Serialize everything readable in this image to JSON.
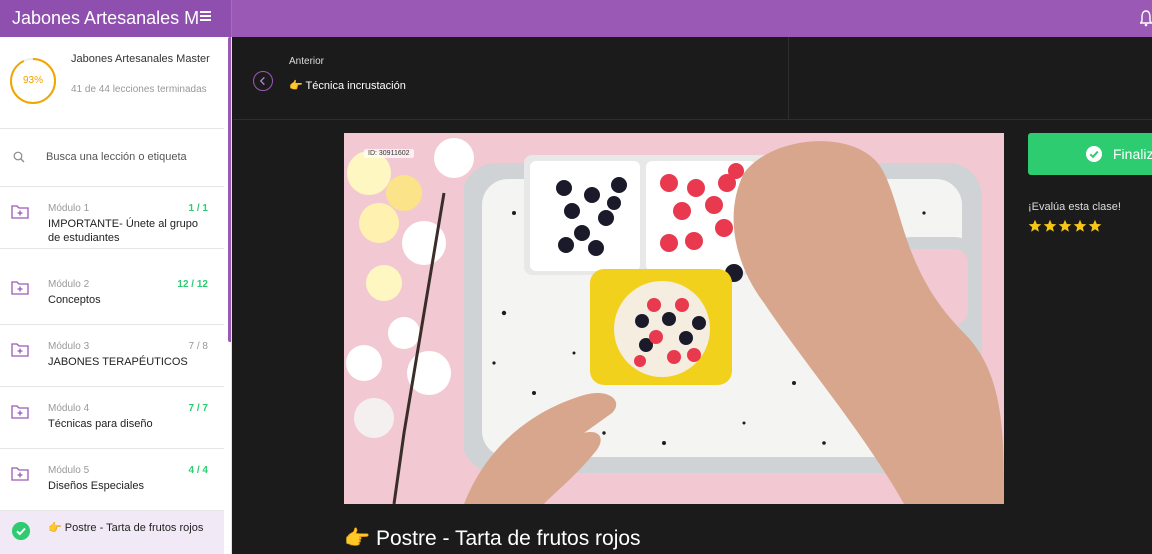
{
  "topbar": {
    "course_name": "Jabones Artesanales M",
    "menu_icon": "hamburger-menu-icon",
    "bell_icon": "bell-icon",
    "brand_color": "#9b59b6"
  },
  "sidebar": {
    "progress_percent": "93%",
    "progress_fraction": 0.93,
    "course_title": "Jabones Artesanales Master",
    "lessons_done": "41 de 44 lecciones terminadas",
    "search_placeholder": "Busca una lección o etiqueta",
    "modules": [
      {
        "num": "Módulo 1",
        "count": "1 / 1",
        "title": "IMPORTANTE- Únete al grupo de estudiantes",
        "complete": true
      },
      {
        "num": "Módulo 2",
        "count": "12 / 12",
        "title": "Conceptos",
        "complete": true
      },
      {
        "num": "Módulo 3",
        "count": "7 / 8",
        "title": "JABONES TERAPÉUTICOS",
        "complete": false
      },
      {
        "num": "Módulo 4",
        "count": "7 / 7",
        "title": "Técnicas para diseño",
        "complete": true
      },
      {
        "num": "Módulo 5",
        "count": "4 / 4",
        "title": "Diseños Especiales",
        "complete": true
      }
    ],
    "active_lesson": "👉 Postre - Tarta de frutos rojos"
  },
  "prev": {
    "label": "Anterior",
    "title": "👉 Técnica incrustación"
  },
  "video": {
    "stock_id": "ID: 30911602"
  },
  "actions": {
    "finish_label": "Finaliza",
    "rate_label": "¡Evalúa esta clase!",
    "stars": 5,
    "success_color": "#2ecc71",
    "star_color": "#f5c518"
  },
  "lesson": {
    "title": "👉 Postre - Tarta de frutos rojos"
  }
}
